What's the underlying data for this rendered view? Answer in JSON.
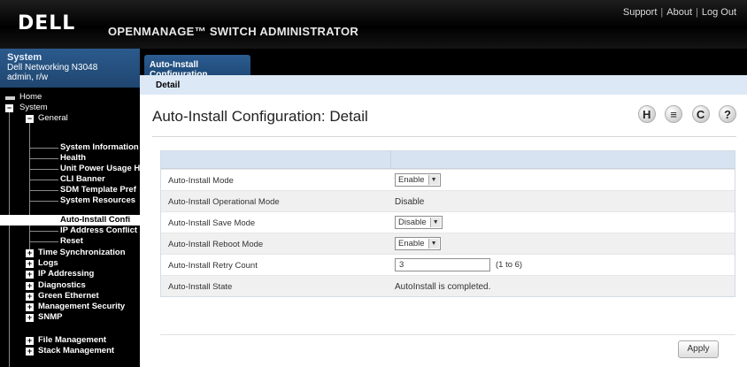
{
  "header": {
    "logo": "DELL",
    "app_title": "OPENMANAGE™ SWITCH ADMINISTRATOR",
    "links": [
      "Support",
      "About",
      "Log Out"
    ]
  },
  "sidebar_header": {
    "title": "System",
    "device": "Dell Networking N3048",
    "user": "admin, r/w"
  },
  "nav": {
    "home": "Home",
    "system": "System",
    "general": "General",
    "general_items": [
      "System Information",
      "Health",
      "Unit Power Usage H",
      "CLI Banner",
      "SDM Template Pref",
      "System Resources",
      "Auto-Install Confi",
      "IP Address Conflict",
      "Reset"
    ],
    "sections": [
      "Time Synchronization",
      "Logs",
      "IP Addressing",
      "Diagnostics",
      "Green Ethernet",
      "Management Security",
      "SNMP",
      "File Management",
      "Stack Management"
    ]
  },
  "tabs": {
    "main": "Auto-Install Configuration",
    "sub": "Detail"
  },
  "page_title": "Auto-Install Configuration: Detail",
  "toolbar_icons": [
    {
      "name": "help-h-icon",
      "glyph": "H"
    },
    {
      "name": "print-icon",
      "glyph": "≡"
    },
    {
      "name": "refresh-icon",
      "glyph": "C"
    },
    {
      "name": "help-icon",
      "glyph": "?"
    }
  ],
  "form": {
    "rows": [
      {
        "label": "Auto-Install Mode",
        "type": "select",
        "value": "Enable"
      },
      {
        "label": "Auto-Install Operational Mode",
        "type": "text",
        "value": "Disable"
      },
      {
        "label": "Auto-Install Save Mode",
        "type": "select",
        "value": "Disable"
      },
      {
        "label": "Auto-Install Reboot Mode",
        "type": "select",
        "value": "Enable"
      },
      {
        "label": "Auto-Install Retry Count",
        "type": "input",
        "value": "3",
        "range": "(1 to 6)"
      },
      {
        "label": "Auto-Install State",
        "type": "text",
        "value": "AutoInstall is completed."
      }
    ]
  },
  "apply_label": "Apply"
}
